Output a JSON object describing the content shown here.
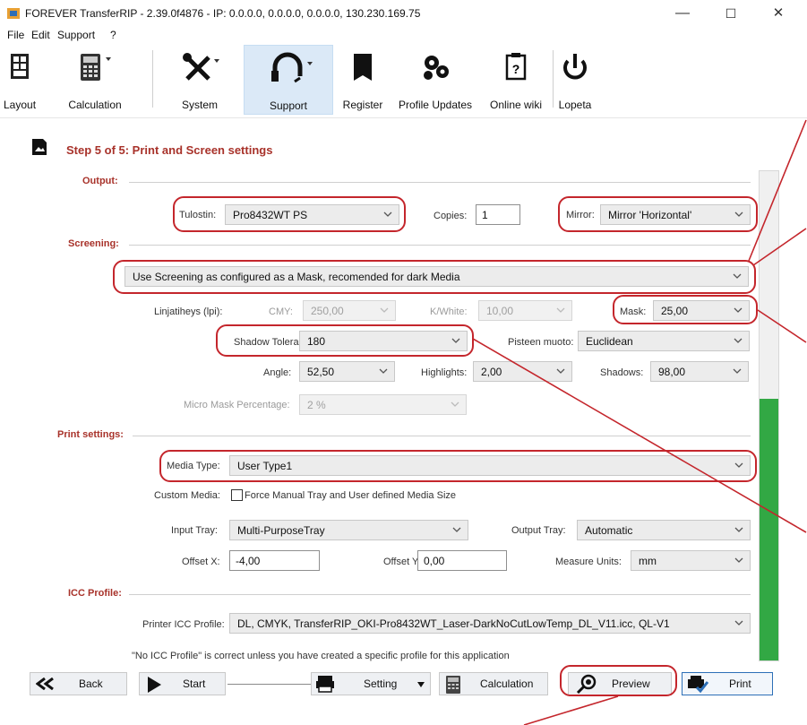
{
  "window": {
    "title": "FOREVER TransferRIP - 2.39.0f4876 - IP: 0.0.0.0, 0.0.0.0, 0.0.0.0, 130.230.169.75",
    "minimize": "—",
    "maximize": "☐",
    "close": "✕"
  },
  "menu": [
    "File",
    "Edit",
    "Support",
    "?"
  ],
  "toolbar": {
    "items": [
      {
        "label": "Layout",
        "icon": "layout-icon"
      },
      {
        "label": "Calculation",
        "icon": "calculator-icon"
      },
      {
        "label": "System",
        "icon": "tools-icon"
      },
      {
        "label": "Support",
        "icon": "headset-icon"
      },
      {
        "label": "Register",
        "icon": "register-icon"
      },
      {
        "label": "Profile Updates",
        "icon": "gears-icon"
      },
      {
        "label": "Online wiki",
        "icon": "wiki-icon"
      },
      {
        "label": "Lopeta",
        "icon": "power-icon"
      }
    ]
  },
  "step": {
    "title": "Step 5 of 5: Print and Screen settings"
  },
  "output": {
    "section": "Output:",
    "printer_label": "Tulostin:",
    "printer_value": "Pro8432WT PS",
    "copies_label": "Copies:",
    "copies_value": "1",
    "mirror_label": "Mirror:",
    "mirror_value": "Mirror 'Horizontal'"
  },
  "screening": {
    "section": "Screening:",
    "mode_value": "Use Screening as configured as a Mask, recomended for dark Media",
    "lpi_label": "Linjatiheys (lpi):",
    "cmy_label": "CMY:",
    "cmy_value": "250,00",
    "kwhite_label": "K/White:",
    "kwhite_value": "10,00",
    "mask_label": "Mask:",
    "mask_value": "25,00",
    "shadow_tol_label": "Shadow Tolerance:",
    "shadow_tol_value": "180",
    "dot_shape_label": "Pisteen muoto:",
    "dot_shape_value": "Euclidean",
    "angle_label": "Angle:",
    "angle_value": "52,50",
    "highlights_label": "Highlights:",
    "highlights_value": "2,00",
    "shadows_label": "Shadows:",
    "shadows_value": "98,00",
    "micro_mask_label": "Micro Mask Percentage:",
    "micro_mask_value": "2 %"
  },
  "print_settings": {
    "section": "Print settings:",
    "media_type_label": "Media Type:",
    "media_type_value": "User Type1",
    "custom_media_label": "Custom Media:",
    "custom_media_checkbox": "Force Manual Tray and User defined Media Size",
    "input_tray_label": "Input Tray:",
    "input_tray_value": "Multi-PurposeTray",
    "output_tray_label": "Output Tray:",
    "output_tray_value": "Automatic",
    "offset_x_label": "Offset X:",
    "offset_x_value": "-4,00",
    "offset_y_label": "Offset Y:",
    "offset_y_value": "0,00",
    "units_label": "Measure Units:",
    "units_value": "mm"
  },
  "icc": {
    "section": "ICC Profile:",
    "printer_icc_label": "Printer ICC Profile:",
    "printer_icc_value": "DL, CMYK, TransferRIP_OKI-Pro8432WT_Laser-DarkNoCutLowTemp_DL_V11.icc, QL-V1",
    "note": "\"No ICC Profile\" is correct unless you have created a specific profile for this application"
  },
  "bottom": {
    "back": "Back",
    "start": "Start",
    "setting": "Setting",
    "calculation": "Calculation",
    "preview": "Preview",
    "print": "Print"
  },
  "colors": {
    "accent_red": "#a8322a",
    "highlight_red": "#c4262c",
    "progress_green": "#32a844",
    "toolbar_active": "#dbe9f7"
  }
}
